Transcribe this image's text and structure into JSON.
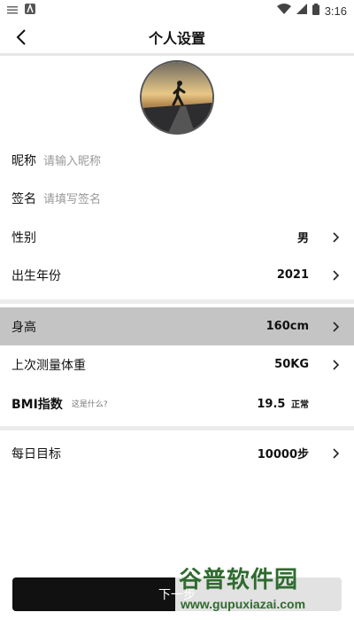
{
  "status_bar": {
    "time": "3:16",
    "left_icons": [
      "notification-icon",
      "app-icon"
    ],
    "right_icons": [
      "wifi-icon",
      "signal-icon",
      "battery-icon"
    ]
  },
  "header": {
    "title": "个人设置",
    "back_icon": "chevron-left-icon"
  },
  "rows": {
    "nickname": {
      "label": "昵称",
      "placeholder": "请输入昵称"
    },
    "signature": {
      "label": "签名",
      "placeholder": "请填写签名"
    },
    "gender": {
      "label": "性别",
      "value": "男"
    },
    "birth_year": {
      "label": "出生年份",
      "value": "2021"
    },
    "height": {
      "label": "身高",
      "value": "160cm"
    },
    "last_weight": {
      "label": "上次测量体重",
      "value": "50KG"
    },
    "bmi": {
      "label": "BMI指数",
      "hint": "这是什么?",
      "value": "19.5",
      "status": "正常"
    },
    "daily_goal": {
      "label": "每日目标",
      "value": "10000步"
    }
  },
  "next_button": {
    "label": "下一步"
  },
  "watermark": {
    "logo": "谷普软件园",
    "url": "www.gupuxiazai.com"
  },
  "colors": {
    "selected_row": "#c4c4c4",
    "button_bg": "#111111",
    "watermark": "#2f6b2f"
  }
}
